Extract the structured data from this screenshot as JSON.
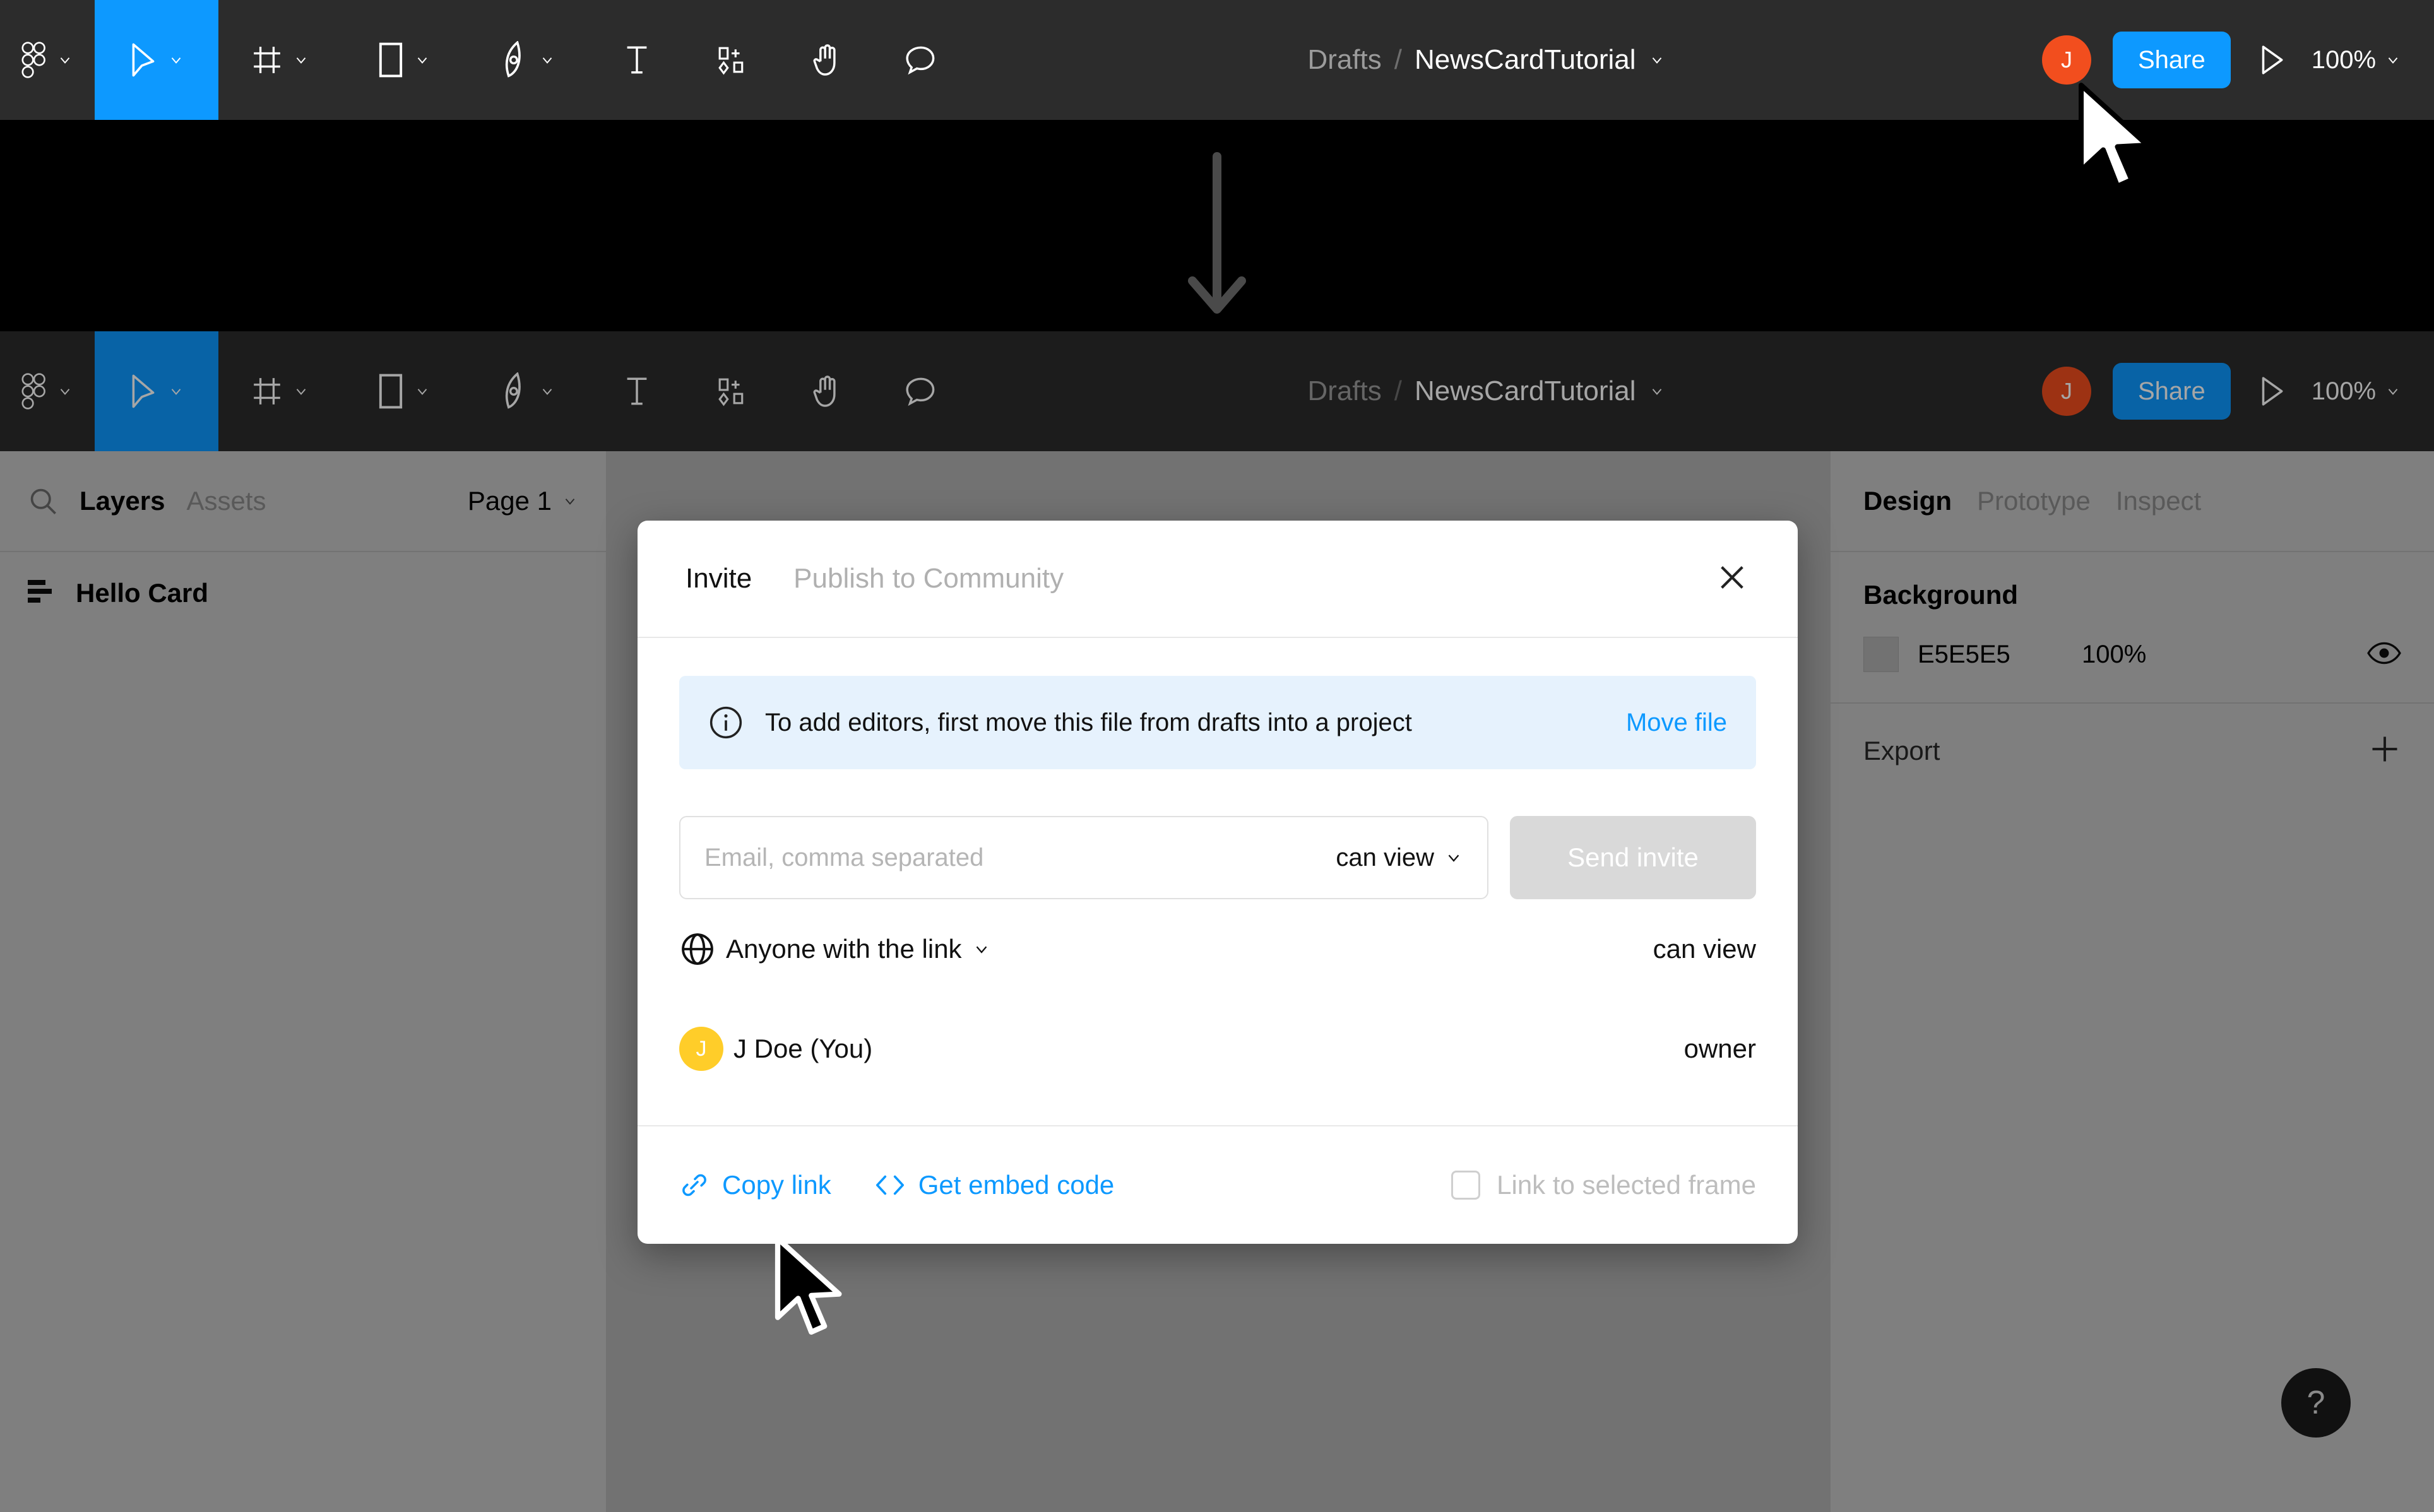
{
  "app": {
    "name": "Figma",
    "accent_blue": "#0d99ff",
    "toolbar_bg": "#2c2c2c",
    "canvas_bg": "#e5e5e5"
  },
  "toolbar": {
    "tools": [
      {
        "name": "figma-logo-icon",
        "has_chevron": true,
        "active": false
      },
      {
        "name": "move-tool-icon",
        "has_chevron": true,
        "active": true
      },
      {
        "name": "frame-tool-icon",
        "has_chevron": true,
        "active": false
      },
      {
        "name": "shape-tool-icon",
        "has_chevron": true,
        "active": false
      },
      {
        "name": "pen-tool-icon",
        "has_chevron": true,
        "active": false
      },
      {
        "name": "text-tool-icon",
        "has_chevron": false,
        "active": false
      },
      {
        "name": "resources-tool-icon",
        "has_chevron": false,
        "active": false
      },
      {
        "name": "hand-tool-icon",
        "has_chevron": false,
        "active": false
      },
      {
        "name": "comment-tool-icon",
        "has_chevron": false,
        "active": false
      }
    ],
    "breadcrumb_project": "Drafts",
    "breadcrumb_separator": "/",
    "breadcrumb_file": "NewsCardTutorial",
    "avatar_initial": "J",
    "share_label": "Share",
    "present_icon": "play-icon",
    "zoom_level": "100%"
  },
  "left_panel": {
    "search_icon": "search-icon",
    "tabs": [
      {
        "label": "Layers",
        "active": true
      },
      {
        "label": "Assets",
        "active": false
      }
    ],
    "page_selector": "Page 1",
    "layers": [
      {
        "name": "Hello Card",
        "icon": "frame-layer-icon"
      }
    ]
  },
  "right_panel": {
    "tabs": [
      {
        "label": "Design",
        "active": true
      },
      {
        "label": "Prototype",
        "active": false
      },
      {
        "label": "Inspect",
        "active": false
      }
    ],
    "background": {
      "title": "Background",
      "hex": "E5E5E5",
      "opacity": "100%",
      "visibility_icon": "eye-icon"
    },
    "export": {
      "title": "Export",
      "add_icon": "plus-icon"
    }
  },
  "annotation": {
    "arrow": "down-arrow-annotation"
  },
  "modal": {
    "tabs": [
      {
        "label": "Invite",
        "active": true
      },
      {
        "label": "Publish to Community",
        "active": false
      }
    ],
    "close_icon": "close-icon",
    "banner": {
      "icon": "info-icon",
      "text": "To add editors, first move this file from drafts into a project",
      "action_label": "Move file",
      "bg": "#e6f2fd"
    },
    "invite": {
      "email_placeholder": "Email, comma separated",
      "email_value": "",
      "permission": "can view",
      "send_label": "Send invite",
      "send_disabled": true
    },
    "share_rows": [
      {
        "icon": "globe-icon",
        "label": "Anyone with the link",
        "has_chevron": true,
        "role": "can view",
        "avatar": null
      },
      {
        "icon": null,
        "label": "J Doe (You)",
        "has_chevron": false,
        "role": "owner",
        "avatar": "J",
        "avatar_color": "#ffcd29"
      }
    ],
    "footer": {
      "copy_link_icon": "link-icon",
      "copy_link_label": "Copy link",
      "embed_icon": "code-icon",
      "embed_label": "Get embed code",
      "checkbox_checked": false,
      "checkbox_label": "Link to selected frame"
    }
  },
  "help": {
    "label": "?"
  },
  "cursors": [
    {
      "name": "cursor-over-share-button",
      "style": "white"
    },
    {
      "name": "cursor-over-copy-link",
      "style": "black"
    }
  ]
}
